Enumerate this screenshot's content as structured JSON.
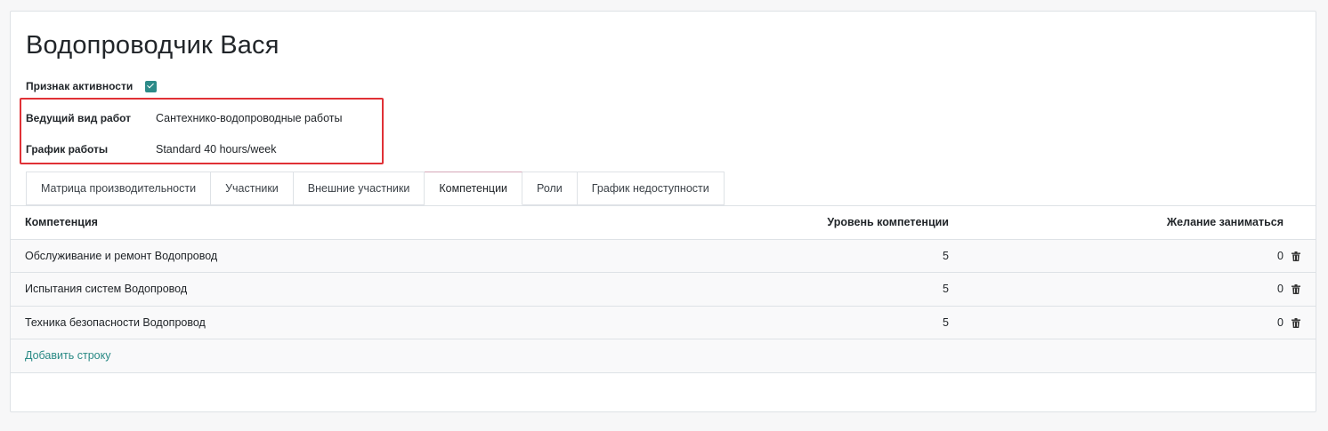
{
  "form": {
    "title": "Водопроводчик Вася",
    "active_label": "Признак активности",
    "active_checked": true,
    "lead_work_label": "Ведущий вид работ",
    "lead_work_value": "Сантехнико-водопроводные работы",
    "schedule_label": "График работы",
    "schedule_value": "Standard 40 hours/week"
  },
  "tabs": [
    {
      "label": "Матрица производительности",
      "active": false
    },
    {
      "label": "Участники",
      "active": false
    },
    {
      "label": "Внешние участники",
      "active": false
    },
    {
      "label": "Компетенции",
      "active": true
    },
    {
      "label": "Роли",
      "active": false
    },
    {
      "label": "График недоступности",
      "active": false
    }
  ],
  "table": {
    "headers": {
      "name": "Компетенция",
      "level": "Уровень компетенции",
      "wish": "Желание заниматься"
    },
    "rows": [
      {
        "name": "Обслуживание и ремонт Водопровод",
        "level": "5",
        "wish": "0"
      },
      {
        "name": "Испытания систем Водопровод",
        "level": "5",
        "wish": "0"
      },
      {
        "name": "Техника безопасности Водопровод",
        "level": "5",
        "wish": "0"
      }
    ],
    "add_row_label": "Добавить строку"
  },
  "icons": {
    "checkbox": "checkbox-checked-icon",
    "delete": "trash-icon"
  },
  "colors": {
    "accent": "#2c8a88",
    "link": "#2a8a85",
    "highlight_border": "#e03136"
  }
}
